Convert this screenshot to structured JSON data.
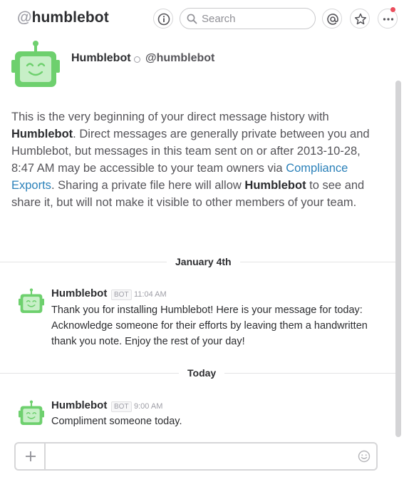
{
  "header": {
    "at_symbol": "@",
    "channel_name": "humblebot",
    "search_placeholder": "Search",
    "icons": [
      "info-icon",
      "search-icon",
      "mentions-icon",
      "star-icon",
      "more-icon"
    ]
  },
  "intro": {
    "bot_name": "Humblebot",
    "handle": "@humblebot",
    "text_1": "This is the very beginning of your direct message history with ",
    "bold_1": "Humblebot",
    "text_2": ". Direct messages are generally private between you and Humblebot, but messages in this team sent on or after 2013-10-28, 8:47 AM may be accessible to your team owners via ",
    "link": "Compliance Exports",
    "text_3": ". Sharing a private file here will allow ",
    "bold_2": "Humblebot",
    "text_4": " to see and share it, but will not make it visible to other members of your team."
  },
  "days": [
    {
      "label": "January 4th",
      "messages": [
        {
          "sender": "Humblebot",
          "badge": "BOT",
          "time": "11:04 AM",
          "body": "Thank you for installing Humblebot! Here is your message for today: Acknowledge someone for their efforts by leaving them a handwritten thank you note. Enjoy the rest of your day!"
        }
      ]
    },
    {
      "label": "Today",
      "messages": [
        {
          "sender": "Humblebot",
          "badge": "BOT",
          "time": "9:00 AM",
          "body": "Compliment someone today."
        }
      ]
    }
  ],
  "composer": {
    "value": "",
    "placeholder": ""
  },
  "colors": {
    "bot_green": "#6ed06e",
    "bot_face": "#c7efc7",
    "link": "#2a80b9",
    "notification": "#eb4d5c"
  }
}
